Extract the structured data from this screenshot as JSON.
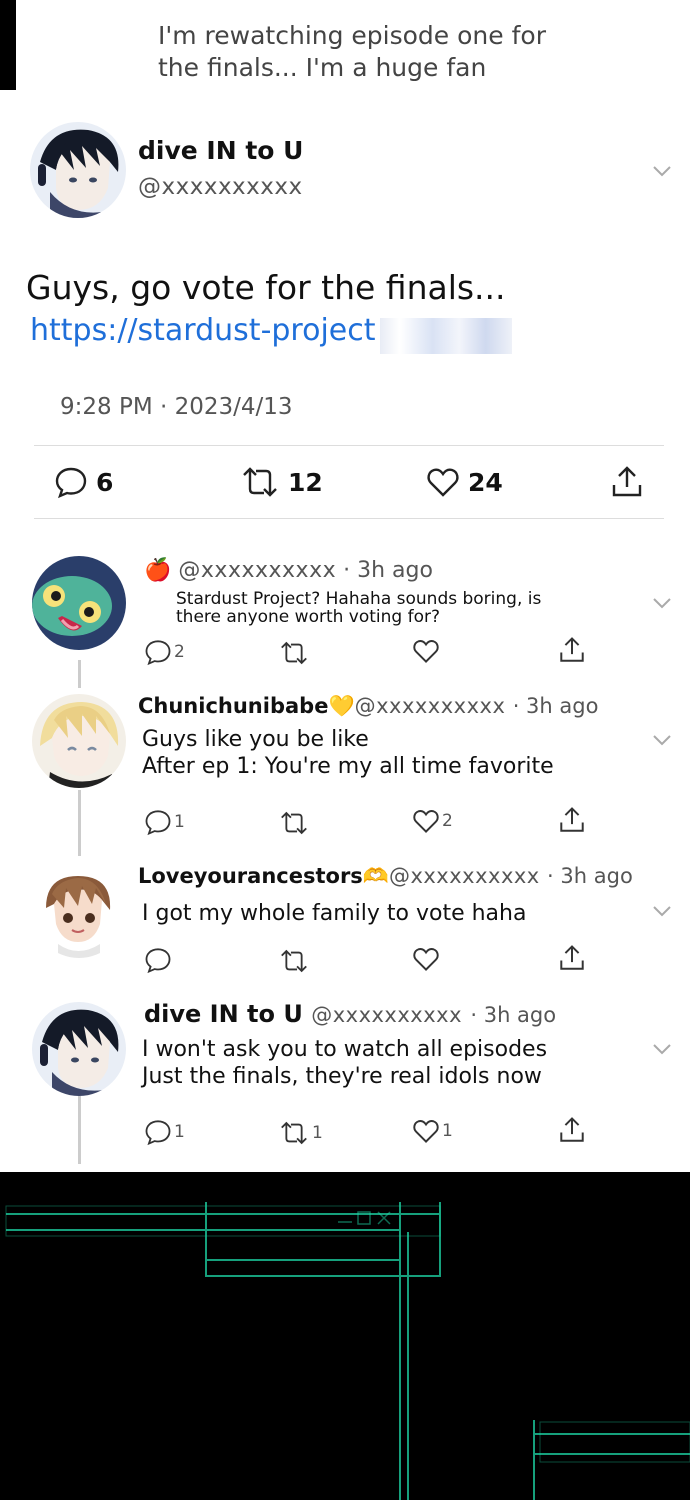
{
  "quote": {
    "line1": "I'm rewatching episode one for",
    "line2": "the finals... I'm a huge fan"
  },
  "main_post": {
    "author": "dive IN to U",
    "handle": "@xxxxxxxxxx",
    "text": "Guys, go vote for the finals...",
    "link": "https://stardust-project",
    "time": "9:28 PM · 2023/4/13",
    "stats": {
      "replies": "6",
      "reposts": "12",
      "likes": "24"
    }
  },
  "replies": [
    {
      "name": "",
      "emoji": "🍎",
      "handle": "@xxxxxxxxxx",
      "time": "· 3h ago",
      "lines": [
        "Stardust Project? Hahaha sounds boring, is",
        "there anyone worth voting for?"
      ],
      "replies": "2",
      "reposts": "",
      "likes": ""
    },
    {
      "name": "Chunichunibabe",
      "emoji": "💛",
      "handle": "@xxxxxxxxxx",
      "time": "· 3h ago",
      "lines": [
        "Guys like you be like",
        "After ep 1: You're my all time favorite"
      ],
      "replies": "1",
      "reposts": "",
      "likes": "2"
    },
    {
      "name": "Loveyourancestors",
      "emoji": "🫶",
      "handle": "@xxxxxxxxxx",
      "time": "· 3h ago",
      "lines": [
        "I got my whole family to vote haha"
      ],
      "replies": "",
      "reposts": "",
      "likes": ""
    },
    {
      "name": "dive IN to U",
      "emoji": "",
      "handle": "@xxxxxxxxxx",
      "time": "· 3h ago",
      "lines": [
        "I won't ask you to watch all episodes",
        "Just the finals, they're real idols now"
      ],
      "replies": "1",
      "reposts": "1",
      "likes": "1"
    }
  ],
  "icons": {
    "reply": "comment-bubble-icon",
    "repost": "repost-arrows-icon",
    "like": "heart-icon",
    "share": "share-upload-icon",
    "more": "chevron-down-icon"
  },
  "colors": {
    "link": "#1f6fd9",
    "text": "#111111",
    "muted": "#555555",
    "glow": "#1ed6a6"
  }
}
